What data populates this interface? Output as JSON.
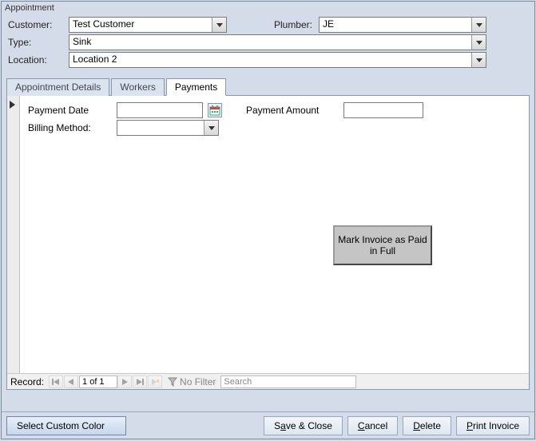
{
  "window": {
    "title": "Appointment"
  },
  "form": {
    "customer_label": "Customer:",
    "customer_value": "Test Customer",
    "plumber_label": "Plumber:",
    "plumber_value": "JE",
    "type_label": "Type:",
    "type_value": "Sink",
    "location_label": "Location:",
    "location_value": "Location 2"
  },
  "tabs": {
    "details": "Appointment Details",
    "workers": "Workers",
    "payments": "Payments"
  },
  "payments": {
    "payment_date_label": "Payment Date",
    "payment_date_value": "",
    "payment_amount_label": "Payment Amount",
    "payment_amount_value": "",
    "billing_method_label": "Billing Method:",
    "billing_method_value": "",
    "mark_paid_button": "Mark Invoice as Paid in Full"
  },
  "recordnav": {
    "label": "Record:",
    "position": "1 of 1",
    "filter_label": "No Filter",
    "search_placeholder": "Search"
  },
  "buttons": {
    "select_custom_color": "Select Custom Color",
    "save_close_pre": "S",
    "save_close_u": "a",
    "save_close_post": "ve & Close",
    "cancel_u": "C",
    "cancel_post": "ancel",
    "delete_u": "D",
    "delete_post": "elete",
    "print_u": "P",
    "print_post": "rint Invoice"
  }
}
